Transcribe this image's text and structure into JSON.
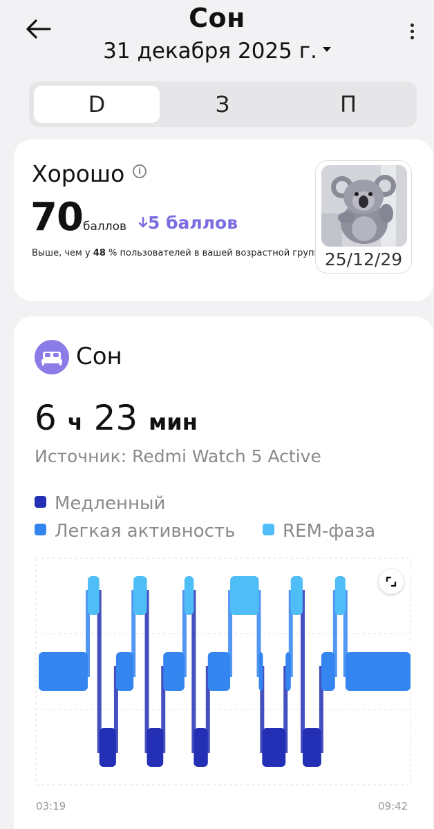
{
  "header": {
    "title": "Сон",
    "date": "31 декабря 2025 г."
  },
  "tabs": [
    {
      "label": "D",
      "active": true
    },
    {
      "label": "З",
      "active": false
    },
    {
      "label": "П",
      "active": false
    }
  ],
  "score": {
    "quality": "Хорошо",
    "value": "70",
    "unit": "баллов",
    "delta": "5 баллов",
    "delta_direction": "down",
    "comparison_prefix": "Выше, чем у ",
    "comparison_value": "48",
    "comparison_suffix": " % пользователей в вашей возрастной группе."
  },
  "badge": {
    "date": "25/12/29",
    "icon": "koala-icon"
  },
  "sleep": {
    "title": "Сон",
    "duration_hours": "6",
    "duration_hours_unit": "ч",
    "duration_minutes": "23",
    "duration_minutes_unit": "мин",
    "source": "Источник: Redmi Watch 5 Active"
  },
  "legend": [
    {
      "label": "Медленный",
      "color": "#2330b5"
    },
    {
      "label": "Легкая активность",
      "color": "#3485ef"
    },
    {
      "label": "REM-фаза",
      "color": "#4fbdf6"
    }
  ],
  "chart": {
    "start_time": "03:19",
    "end_time": "09:42",
    "colors": {
      "deep": "#2330b5",
      "light": "#3485ef",
      "rem": "#4fbdf6"
    },
    "stages": [
      {
        "stage": "light",
        "start": 0.0,
        "end": 0.132
      },
      {
        "stage": "rem",
        "start": 0.132,
        "end": 0.163
      },
      {
        "stage": "deep",
        "start": 0.163,
        "end": 0.208
      },
      {
        "stage": "light",
        "start": 0.208,
        "end": 0.255
      },
      {
        "stage": "rem",
        "start": 0.255,
        "end": 0.291
      },
      {
        "stage": "deep",
        "start": 0.291,
        "end": 0.335
      },
      {
        "stage": "light",
        "start": 0.335,
        "end": 0.392
      },
      {
        "stage": "rem",
        "start": 0.392,
        "end": 0.417
      },
      {
        "stage": "deep",
        "start": 0.417,
        "end": 0.455
      },
      {
        "stage": "light",
        "start": 0.455,
        "end": 0.515
      },
      {
        "stage": "rem",
        "start": 0.515,
        "end": 0.592
      },
      {
        "stage": "light",
        "start": 0.592,
        "end": 0.601
      },
      {
        "stage": "deep",
        "start": 0.601,
        "end": 0.664
      },
      {
        "stage": "light",
        "start": 0.664,
        "end": 0.678
      },
      {
        "stage": "rem",
        "start": 0.678,
        "end": 0.71
      },
      {
        "stage": "deep",
        "start": 0.71,
        "end": 0.76
      },
      {
        "stage": "light",
        "start": 0.76,
        "end": 0.797
      },
      {
        "stage": "rem",
        "start": 0.797,
        "end": 0.825
      },
      {
        "stage": "light",
        "start": 0.825,
        "end": 1.0
      }
    ]
  }
}
